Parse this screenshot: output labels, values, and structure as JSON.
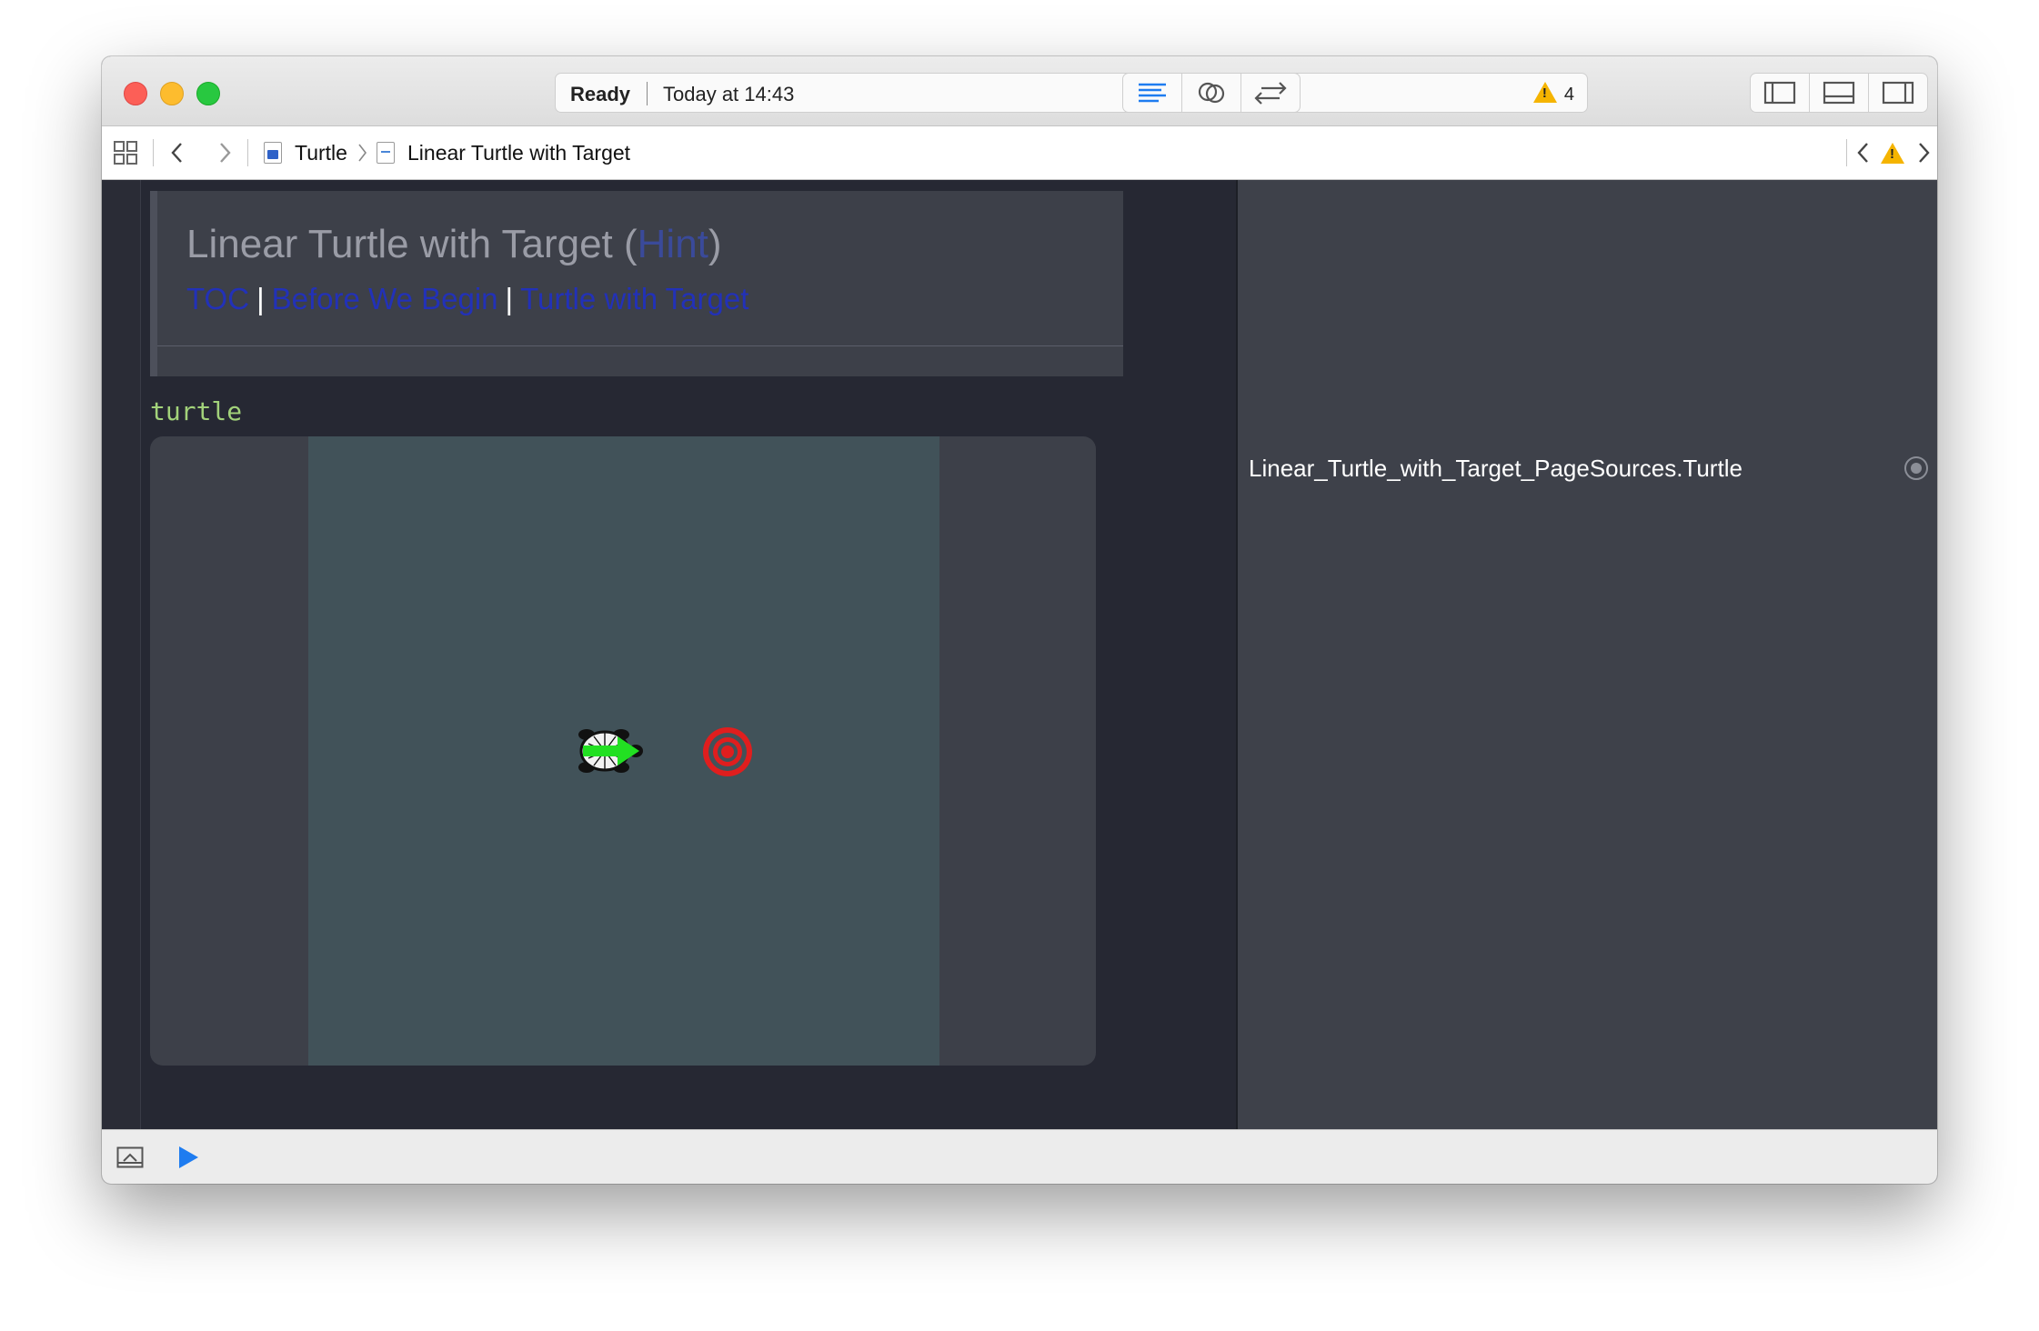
{
  "toolbar": {
    "status_state": "Ready",
    "status_time": "Today at 14:43",
    "warning_count": "4",
    "editor_modes": [
      "standard-editor-icon",
      "assistant-editor-icon",
      "version-editor-icon"
    ],
    "panels": [
      "navigator-panel-icon",
      "debug-panel-icon",
      "utilities-panel-icon"
    ]
  },
  "jumpbar": {
    "crumbs": [
      {
        "label": "Turtle",
        "icon": "playground-file-icon"
      },
      {
        "label": "Linear Turtle with Target",
        "icon": "playground-page-icon"
      }
    ]
  },
  "doc": {
    "title_prefix": "Linear Turtle with Target (",
    "hint_link": "Hint",
    "title_suffix": ")",
    "links": [
      "TOC",
      "Before We Begin",
      "Turtle with Target"
    ],
    "separator": "|"
  },
  "code": {
    "line": "turtle"
  },
  "live_view": {
    "sprites": [
      "turtle-sprite",
      "target-sprite"
    ],
    "colors": {
      "canvas": "#415259",
      "arrow": "#22e022",
      "target": "#e01e1e"
    }
  },
  "results": {
    "value": "Linear_Turtle_with_Target_PageSources.Turtle"
  },
  "colors": {
    "accent": "#1e7cf0",
    "link": "#2231b8",
    "code_identifier": "#a2d27a",
    "warning": "#f5b400"
  }
}
